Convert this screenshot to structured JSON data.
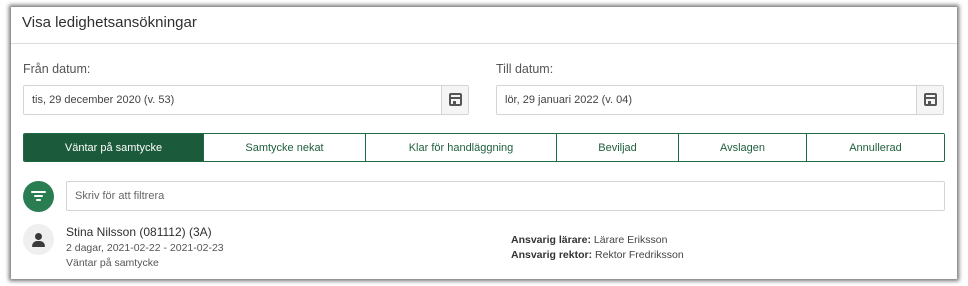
{
  "header": {
    "title": "Visa ledighetsansökningar"
  },
  "date_filter": {
    "from": {
      "label": "Från datum:",
      "value": "tis, 29 december 2020 (v. 53)",
      "icon": "calendar-icon"
    },
    "to": {
      "label": "Till datum:",
      "value": "lör, 29 januari 2022 (v. 04)",
      "icon": "calendar-icon"
    }
  },
  "status_tabs": [
    {
      "label": "Väntar på samtycke",
      "active": true
    },
    {
      "label": "Samtycke nekat",
      "active": false
    },
    {
      "label": "Klar för handläggning",
      "active": false
    },
    {
      "label": "Beviljad",
      "active": false
    },
    {
      "label": "Avslagen",
      "active": false
    },
    {
      "label": "Annullerad",
      "active": false
    }
  ],
  "filter": {
    "placeholder": "Skriv för att filtrera",
    "value": "",
    "icon": "filter-icon"
  },
  "applications": [
    {
      "name": "Stina Nilsson (081112) (3A)",
      "dates": "2 dagar, 2021-02-22 - 2021-02-23",
      "status": "Väntar på samtycke",
      "teacher_label": "Ansvarig lärare:",
      "teacher": "Lärare Eriksson",
      "principal_label": "Ansvarig rektor:",
      "principal": "Rektor Fredriksson",
      "icon": "person-icon"
    }
  ],
  "colors": {
    "accent": "#1b5a3a",
    "accent_light": "#2a7d50",
    "border": "#d4d4d4"
  }
}
